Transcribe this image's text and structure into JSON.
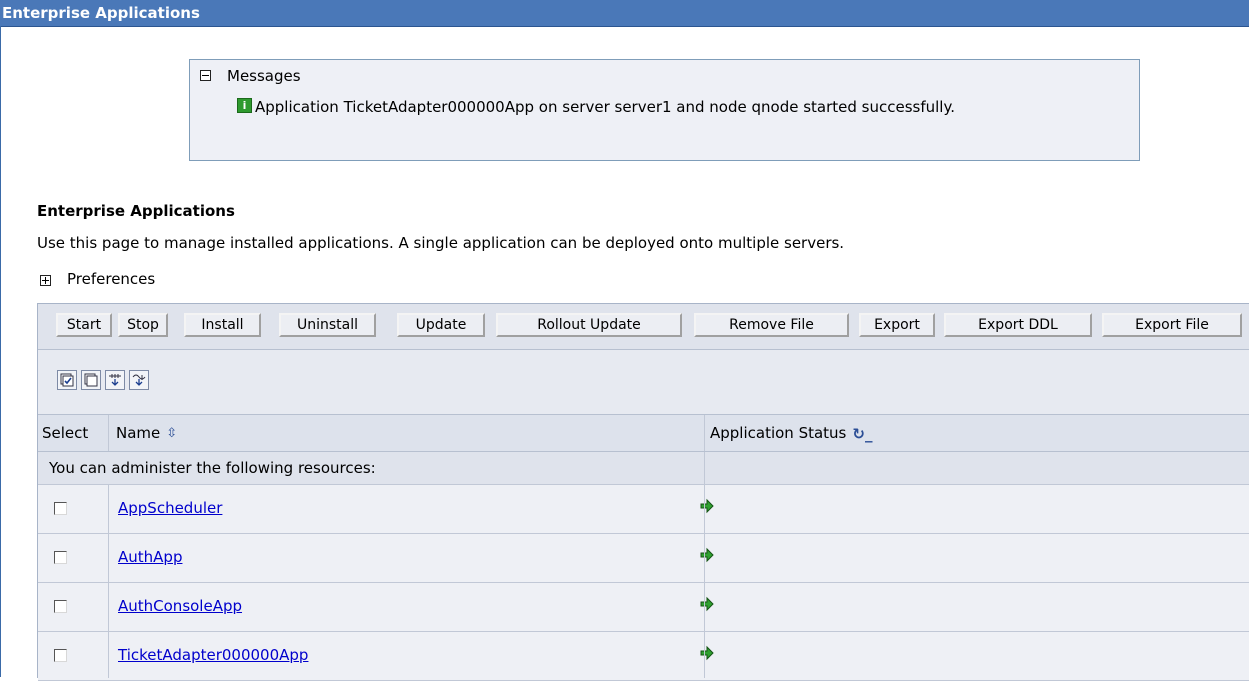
{
  "page": {
    "title": "Enterprise Applications"
  },
  "messages": {
    "title": "Messages",
    "text": "Application TicketAdapter000000App on server server1 and node qnode started successfully."
  },
  "section": {
    "heading": "Enterprise Applications",
    "description": "Use this page to manage installed applications. A single application can be deployed onto multiple servers.",
    "preferences_label": "Preferences"
  },
  "toolbar": {
    "start": "Start",
    "stop": "Stop",
    "install": "Install",
    "uninstall": "Uninstall",
    "update": "Update",
    "rollout_update": "Rollout Update",
    "remove_file": "Remove File",
    "export": "Export",
    "export_ddl": "Export DDL",
    "export_file": "Export File"
  },
  "table": {
    "columns": {
      "select": "Select",
      "name": "Name",
      "status": "Application Status"
    },
    "group_label": "You can administer the following resources:",
    "rows": [
      {
        "name": "AppScheduler",
        "status": "started"
      },
      {
        "name": "AuthApp",
        "status": "started"
      },
      {
        "name": "AuthConsoleApp",
        "status": "started"
      },
      {
        "name": "TicketAdapter000000App",
        "status": "started"
      }
    ]
  },
  "icons": {
    "select_all": "select-all-icon",
    "deselect_all": "deselect-all-icon",
    "show_filter": "show-filter-icon",
    "clear_filter": "clear-filter-icon",
    "status_started": "started-arrow-icon"
  },
  "colors": {
    "titlebar": "#4a78b8",
    "link": "#0000cc",
    "started": "#2fa02f"
  }
}
